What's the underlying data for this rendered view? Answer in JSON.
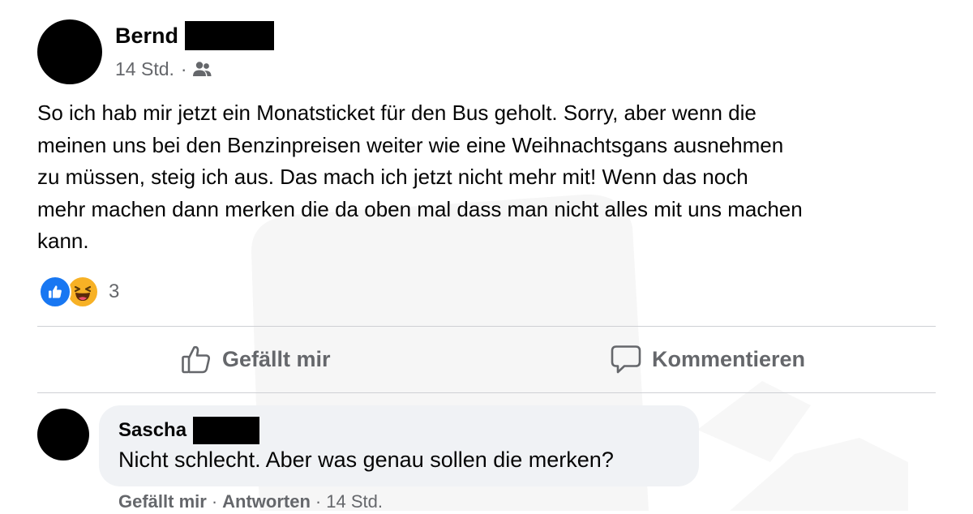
{
  "post": {
    "author": "Bernd",
    "time": "14 Std.",
    "separator": "·",
    "audience_icon": "friends-icon",
    "text_lines": [
      "So ich hab mir jetzt ein Monatsticket für den Bus geholt. Sorry, aber wenn die",
      "meinen uns bei den Benzinpreisen weiter wie eine Weihnachtsgans ausnehmen",
      "zu müssen, steig ich aus. Das mach ich jetzt nicht mehr mit! Wenn das noch",
      "mehr machen dann merken die da oben mal dass man nicht alles mit uns machen",
      "kann."
    ],
    "reactions": {
      "types": [
        "like",
        "haha"
      ],
      "count": "3",
      "like_color": "#1877f2",
      "haha_color": "#f7b125"
    }
  },
  "actions": {
    "like_label": "Gefällt mir",
    "comment_label": "Kommentieren"
  },
  "comment": {
    "author": "Sascha",
    "text": "Nicht schlecht. Aber was genau sollen die merken?",
    "like_label": "Gefällt mir",
    "reply_label": "Antworten",
    "separator": "·",
    "time": "14 Std."
  },
  "colors": {
    "text": "#050505",
    "secondary": "#65676b",
    "bubble": "#f0f2f5",
    "divider": "#ced0d4"
  }
}
